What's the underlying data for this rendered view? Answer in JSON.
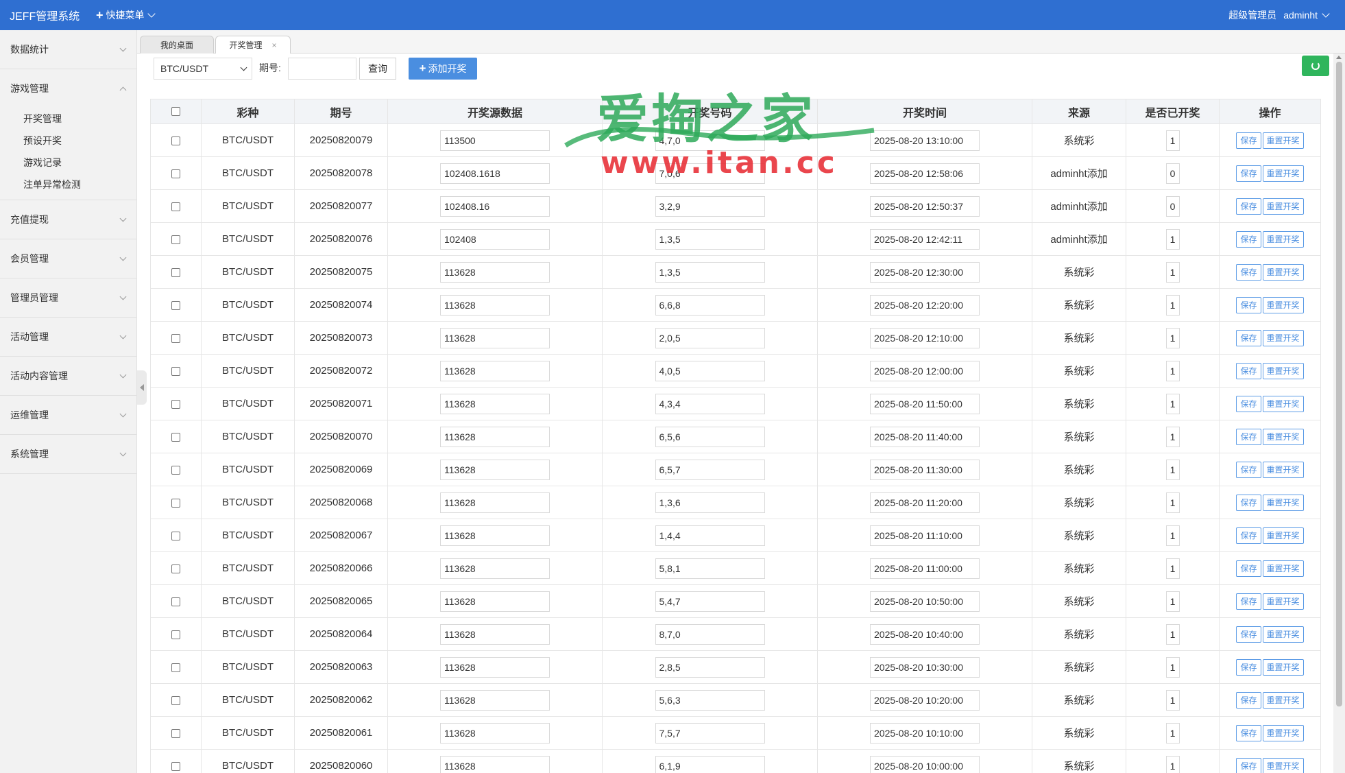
{
  "header": {
    "brand": "JEFF管理系统",
    "quick_menu": "快捷菜单",
    "role": "超级管理员",
    "username": "adminht"
  },
  "sidebar": {
    "groups": [
      {
        "label": "数据统计",
        "expanded": false
      },
      {
        "label": "游戏管理",
        "expanded": true,
        "items": [
          "开奖管理",
          "预设开奖",
          "游戏记录",
          "注单异常检测"
        ]
      },
      {
        "label": "充值提现",
        "expanded": false
      },
      {
        "label": "会员管理",
        "expanded": false
      },
      {
        "label": "管理员管理",
        "expanded": false
      },
      {
        "label": "活动管理",
        "expanded": false
      },
      {
        "label": "活动内容管理",
        "expanded": false
      },
      {
        "label": "运维管理",
        "expanded": false
      },
      {
        "label": "系统管理",
        "expanded": false
      }
    ]
  },
  "tabs": [
    {
      "label": "我的桌面"
    },
    {
      "label": "开奖管理",
      "close": "×",
      "active": true
    }
  ],
  "toolbar": {
    "lottery_select": "BTC/USDT",
    "period_label": "期号:",
    "period_value": "",
    "query_button": "查询",
    "add_button": "添加开奖"
  },
  "table": {
    "headers": [
      "彩种",
      "期号",
      "开奖源数据",
      "开奖号码",
      "开奖时间",
      "来源",
      "是否已开奖",
      "操作"
    ],
    "save_label": "保存",
    "reset_label": "重置开奖",
    "rows": [
      {
        "lottery": "BTC/USDT",
        "period": "20250820079",
        "source_data": "113500",
        "numbers": "4,7,0",
        "time": "2025-08-20 13:10:00",
        "origin": "系统彩",
        "drawn": "1"
      },
      {
        "lottery": "BTC/USDT",
        "period": "20250820078",
        "source_data": "102408.1618",
        "numbers": "7,0,6",
        "time": "2025-08-20 12:58:06",
        "origin": "adminht添加",
        "drawn": "0"
      },
      {
        "lottery": "BTC/USDT",
        "period": "20250820077",
        "source_data": "102408.16",
        "numbers": "3,2,9",
        "time": "2025-08-20 12:50:37",
        "origin": "adminht添加",
        "drawn": "0"
      },
      {
        "lottery": "BTC/USDT",
        "period": "20250820076",
        "source_data": "102408",
        "numbers": "1,3,5",
        "time": "2025-08-20 12:42:11",
        "origin": "adminht添加",
        "drawn": "1"
      },
      {
        "lottery": "BTC/USDT",
        "period": "20250820075",
        "source_data": "113628",
        "numbers": "1,3,5",
        "time": "2025-08-20 12:30:00",
        "origin": "系统彩",
        "drawn": "1"
      },
      {
        "lottery": "BTC/USDT",
        "period": "20250820074",
        "source_data": "113628",
        "numbers": "6,6,8",
        "time": "2025-08-20 12:20:00",
        "origin": "系统彩",
        "drawn": "1"
      },
      {
        "lottery": "BTC/USDT",
        "period": "20250820073",
        "source_data": "113628",
        "numbers": "2,0,5",
        "time": "2025-08-20 12:10:00",
        "origin": "系统彩",
        "drawn": "1"
      },
      {
        "lottery": "BTC/USDT",
        "period": "20250820072",
        "source_data": "113628",
        "numbers": "4,0,5",
        "time": "2025-08-20 12:00:00",
        "origin": "系统彩",
        "drawn": "1"
      },
      {
        "lottery": "BTC/USDT",
        "period": "20250820071",
        "source_data": "113628",
        "numbers": "4,3,4",
        "time": "2025-08-20 11:50:00",
        "origin": "系统彩",
        "drawn": "1"
      },
      {
        "lottery": "BTC/USDT",
        "period": "20250820070",
        "source_data": "113628",
        "numbers": "6,5,6",
        "time": "2025-08-20 11:40:00",
        "origin": "系统彩",
        "drawn": "1"
      },
      {
        "lottery": "BTC/USDT",
        "period": "20250820069",
        "source_data": "113628",
        "numbers": "6,5,7",
        "time": "2025-08-20 11:30:00",
        "origin": "系统彩",
        "drawn": "1"
      },
      {
        "lottery": "BTC/USDT",
        "period": "20250820068",
        "source_data": "113628",
        "numbers": "1,3,6",
        "time": "2025-08-20 11:20:00",
        "origin": "系统彩",
        "drawn": "1"
      },
      {
        "lottery": "BTC/USDT",
        "period": "20250820067",
        "source_data": "113628",
        "numbers": "1,4,4",
        "time": "2025-08-20 11:10:00",
        "origin": "系统彩",
        "drawn": "1"
      },
      {
        "lottery": "BTC/USDT",
        "period": "20250820066",
        "source_data": "113628",
        "numbers": "5,8,1",
        "time": "2025-08-20 11:00:00",
        "origin": "系统彩",
        "drawn": "1"
      },
      {
        "lottery": "BTC/USDT",
        "period": "20250820065",
        "source_data": "113628",
        "numbers": "5,4,7",
        "time": "2025-08-20 10:50:00",
        "origin": "系统彩",
        "drawn": "1"
      },
      {
        "lottery": "BTC/USDT",
        "period": "20250820064",
        "source_data": "113628",
        "numbers": "8,7,0",
        "time": "2025-08-20 10:40:00",
        "origin": "系统彩",
        "drawn": "1"
      },
      {
        "lottery": "BTC/USDT",
        "period": "20250820063",
        "source_data": "113628",
        "numbers": "2,8,5",
        "time": "2025-08-20 10:30:00",
        "origin": "系统彩",
        "drawn": "1"
      },
      {
        "lottery": "BTC/USDT",
        "period": "20250820062",
        "source_data": "113628",
        "numbers": "5,6,3",
        "time": "2025-08-20 10:20:00",
        "origin": "系统彩",
        "drawn": "1"
      },
      {
        "lottery": "BTC/USDT",
        "period": "20250820061",
        "source_data": "113628",
        "numbers": "7,5,7",
        "time": "2025-08-20 10:10:00",
        "origin": "系统彩",
        "drawn": "1"
      },
      {
        "lottery": "BTC/USDT",
        "period": "20250820060",
        "source_data": "113628",
        "numbers": "6,1,9",
        "time": "2025-08-20 10:00:00",
        "origin": "系统彩",
        "drawn": "1"
      }
    ]
  },
  "watermark": {
    "title": "爱掏之家",
    "url": "www.itan.cc"
  },
  "colors": {
    "header_bg": "#2f6fd1",
    "primary_button": "#4a8ee0",
    "refresh_button": "#2fb55c",
    "watermark_green": "#2eaa5a",
    "watermark_red": "#e8333a"
  }
}
